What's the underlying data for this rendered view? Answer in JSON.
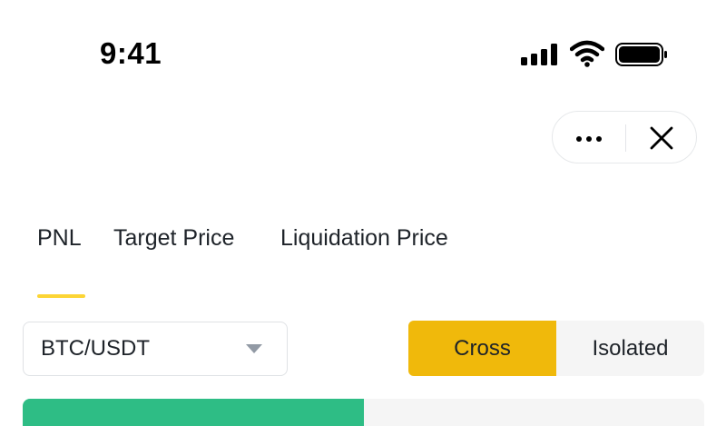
{
  "status_bar": {
    "time": "9:41"
  },
  "capsule": {
    "more_icon": "more-dots-icon",
    "close_icon": "close-icon"
  },
  "tabs": [
    {
      "label": "PNL",
      "active": true
    },
    {
      "label": "Target Price",
      "active": false
    },
    {
      "label": "Liquidation Price",
      "active": false
    }
  ],
  "pair_selector": {
    "value": "BTC/USDT",
    "icon": "caret-down-icon"
  },
  "margin_mode": {
    "options": [
      "Cross",
      "Isolated"
    ],
    "selected": "Cross"
  },
  "colors": {
    "accent": "#fcd535",
    "cross_selected": "#f0b90b",
    "long_green": "#2ebd85",
    "segment_bg": "#f5f5f5"
  }
}
